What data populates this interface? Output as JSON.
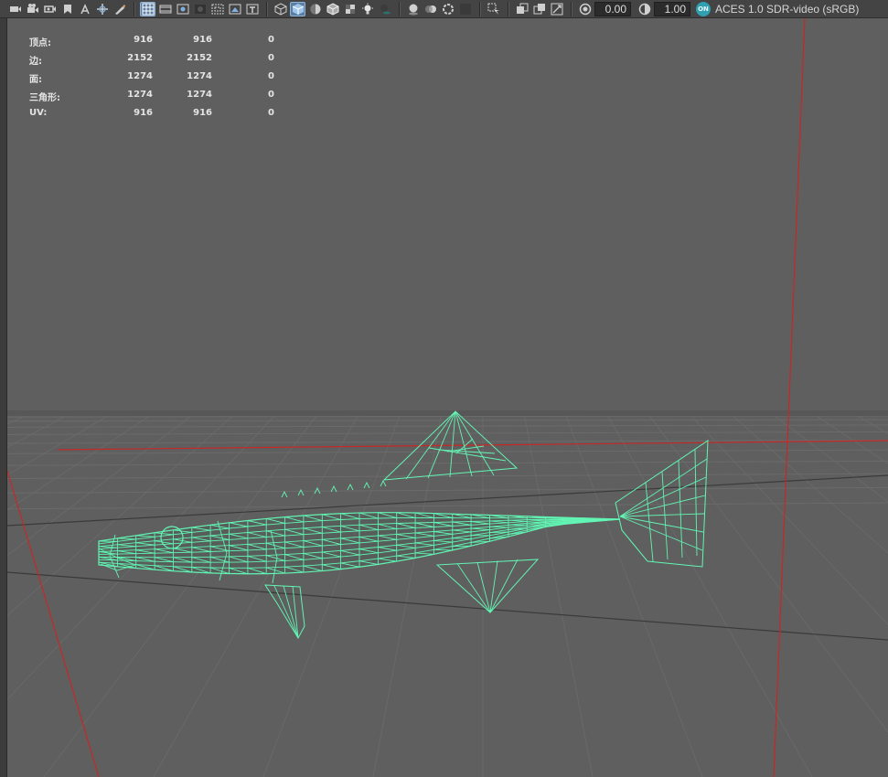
{
  "toolbar": {
    "icons": [
      "camera-icon",
      "camera-attributes-icon",
      "bookmark-camera-icon",
      "image-plane-icon",
      "bookmark-icon",
      "2d-pan-zoom-icon",
      "grease-pencil-icon",
      "pencil-icon",
      "grid-icon",
      "film-gate-icon",
      "resolution-gate-icon",
      "gate-mask-icon",
      "field-chart-icon",
      "safe-action-icon",
      "safe-title-icon",
      "wireframe-icon",
      "smooth-shade-icon",
      "default-material-icon",
      "shaded-wireframe-icon",
      "textured-icon",
      "use-lights-icon",
      "shadows-icon",
      "ambient-occlusion-icon",
      "motion-blur-icon",
      "anti-aliasing-icon",
      "depth-of-field-icon",
      "isolate-select-icon",
      "xray-icon",
      "xray-active-icon",
      "xray-joints-icon",
      "exposure-icon",
      "gamma-icon",
      "color-management-icon"
    ],
    "exposure_value": "0.00",
    "gamma_value": "1.00",
    "color_space_label": "ACES 1.0 SDR-video (sRGB)",
    "color_space_badge": "ON",
    "active_icons": [
      "grid-icon",
      "smooth-shade-icon"
    ]
  },
  "hud": {
    "rows": [
      {
        "label": "顶点:",
        "c1": "916",
        "c2": "916",
        "c3": "0"
      },
      {
        "label": "边:",
        "c1": "2152",
        "c2": "2152",
        "c3": "0"
      },
      {
        "label": "面:",
        "c1": "1274",
        "c2": "1274",
        "c3": "0"
      },
      {
        "label": "三角形:",
        "c1": "1274",
        "c2": "1274",
        "c3": "0"
      },
      {
        "label": "UV:",
        "c1": "916",
        "c2": "916",
        "c3": "0"
      }
    ]
  },
  "colors": {
    "background": "#5f5f5f",
    "grid": "#6b6b6b",
    "axis_red": "#c62828",
    "axis_dark": "#3a3a3a",
    "wireframe": "#62f5b4",
    "wire_dark": "#0f1f18"
  }
}
